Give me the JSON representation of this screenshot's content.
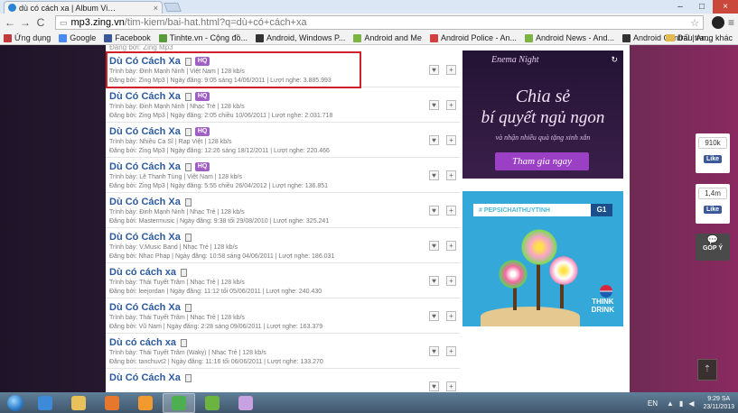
{
  "browser": {
    "tab_title": "dù có cách xa | Album Vi…",
    "tab_close": "×",
    "window_controls": {
      "minimize": "–",
      "maximize": "□",
      "close": "×"
    },
    "nav": {
      "back": "←",
      "forward": "→",
      "reload": "C"
    },
    "url_host": "mp3.zing.vn",
    "url_path": "/tim-kiem/bai-hat.html?q=dù+có+cách+xa",
    "star": "☆",
    "menu": "≡",
    "bookmarks": [
      {
        "label": "Ứng dụng",
        "color": "#c23b3b"
      },
      {
        "label": "Google",
        "color": "#4a8af4"
      },
      {
        "label": "Facebook",
        "color": "#3b5998"
      },
      {
        "label": "Tinhte.vn - Cộng đồ...",
        "color": "#5a9a3a"
      },
      {
        "label": "Android, Windows P...",
        "color": "#333333"
      },
      {
        "label": "Android and Me",
        "color": "#7cb342"
      },
      {
        "label": "Android Police - An...",
        "color": "#d23f3f"
      },
      {
        "label": "Android News - And...",
        "color": "#7cb342"
      },
      {
        "label": "Android Central | An...",
        "color": "#333333"
      }
    ],
    "other_bookmarks": "Dấu trang khác"
  },
  "prev_item_tail": "Đăng bởi: Zing Mp3",
  "songs": [
    {
      "title": "Dù Có Cách Xa",
      "hq": "HQ",
      "artist_line": "Trình bày: Đinh Mạnh Ninh | Việt Nam | 128 kb/s",
      "upload_line": "Đăng bởi: Zing Mp3 | Ngày đăng: 9:05 sáng 14/06/2011 | Lượt nghe: 3.885.993"
    },
    {
      "title": "Dù Có Cách Xa",
      "hq": "HQ",
      "artist_line": "Trình bày: Đinh Mạnh Ninh | Nhạc Trẻ | 128 kb/s",
      "upload_line": "Đăng bởi: Zing Mp3 | Ngày đăng: 2:05 chiều 10/06/2011 | Lượt nghe: 2.031.718"
    },
    {
      "title": "Dù Có Cách Xa",
      "hq": "HQ",
      "artist_line": "Trình bày: Nhiều Ca Sĩ | Rap Việt | 128 kb/s",
      "upload_line": "Đăng bởi: Zing Mp3 | Ngày đăng: 12:26 sáng 18/12/2011 | Lượt nghe: 220.466"
    },
    {
      "title": "Dù Có Cách Xa",
      "hq": "HQ",
      "artist_line": "Trình bày: Lê Thanh Tùng | Việt Nam | 128 kb/s",
      "upload_line": "Đăng bởi: Zing Mp3 | Ngày đăng: 5:55 chiều 26/04/2012 | Lượt nghe: 136.851"
    },
    {
      "title": "Dù Có Cách Xa",
      "hq": "",
      "artist_line": "Trình bày: Đinh Mạnh Ninh | Nhạc Trẻ | 128 kb/s",
      "upload_line": "Đăng bởi: Mastermusic | Ngày đăng: 9:38 tối 29/08/2010 | Lượt nghe: 325.241"
    },
    {
      "title": "Dù Có Cách Xa",
      "hq": "",
      "artist_line": "Trình bày: V.Music Band | Nhạc Trẻ | 128 kb/s",
      "upload_line": "Đăng bởi: Nhac Phap | Ngày đăng: 10:58 sáng 04/06/2011 | Lượt nghe: 186.031"
    },
    {
      "title": "Dù có cách xa",
      "hq": "",
      "artist_line": "Trình bày: Thái Tuyết Trâm | Nhạc Trẻ | 128 kb/s",
      "upload_line": "Đăng bởi: leejordan | Ngày đăng: 11:12 tối 05/06/2011 | Lượt nghe: 240.430"
    },
    {
      "title": "Dù Có Cách Xa",
      "hq": "",
      "artist_line": "Trình bày: Thái Tuyết Trâm | Nhạc Trẻ | 128 kb/s",
      "upload_line": "Đăng bởi: Vũ Nam | Ngày đăng: 2:28 sáng 09/06/2011 | Lượt nghe: 163.379"
    },
    {
      "title": "Dù có cách xa",
      "hq": "",
      "artist_line": "Trình bày: Thái Tuyết Trâm (Waky) | Nhạc Trẻ | 128 kb/s",
      "upload_line": "Đăng bởi: tanchuvt2 | Ngày đăng: 11:16 tối 06/06/2011 | Lượt nghe: 133.270"
    },
    {
      "title": "Dù Có Cách Xa",
      "hq": "",
      "artist_line": "",
      "upload_line": ""
    }
  ],
  "song_actions": {
    "add_to_album": "♥",
    "add": "+"
  },
  "ad_top": {
    "brand": "Enema Night",
    "line1": "Chia sẻ",
    "line2": "bí quyết ngủ ngon",
    "sub": "và nhận nhiều quà tặng xinh xắn",
    "cta": "Tham gia ngay",
    "refresh": "↻"
  },
  "ad_bottom": {
    "hashtag": "# PEPSICHAITHUYTINH",
    "badge": "G1",
    "slogan_1": "THINK",
    "slogan_2": "DRINK"
  },
  "social": {
    "fb_count": "910k",
    "fb_like": "Like",
    "fb2_count": "1,4m",
    "fb2_like": "Like",
    "feedback_icon": "💬",
    "feedback_label": "GÓP Ý",
    "scroll_top": "⇡"
  },
  "taskbar": {
    "apps": [
      {
        "name": "internet-explorer",
        "color": "#3c8ad8",
        "active": false
      },
      {
        "name": "file-explorer",
        "color": "#e9c15a",
        "active": false
      },
      {
        "name": "firefox",
        "color": "#e8772e",
        "active": false
      },
      {
        "name": "media-player",
        "color": "#f29a2e",
        "active": false
      },
      {
        "name": "chrome",
        "color": "#4caf50",
        "active": true
      },
      {
        "name": "network",
        "color": "#6cb33f",
        "active": false
      },
      {
        "name": "paint",
        "color": "#c8a2e0",
        "active": false
      }
    ],
    "lang": "EN",
    "time": "9:29 SA",
    "date": "23/11/2013"
  }
}
